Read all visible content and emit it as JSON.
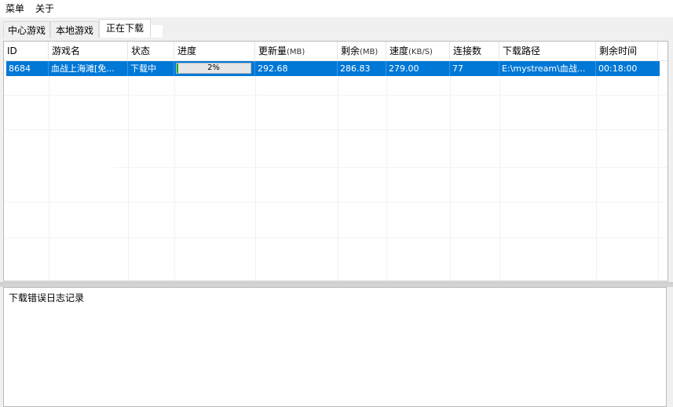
{
  "menu": {
    "items": [
      "菜单",
      "关于"
    ]
  },
  "tabs": [
    {
      "label": "中心游戏",
      "active": false
    },
    {
      "label": "本地游戏",
      "active": false
    },
    {
      "label": "正在下载",
      "active": true
    }
  ],
  "table": {
    "columns": [
      {
        "label": "ID",
        "unit": ""
      },
      {
        "label": "游戏名",
        "unit": ""
      },
      {
        "label": "状态",
        "unit": ""
      },
      {
        "label": "进度",
        "unit": ""
      },
      {
        "label": "更新量",
        "unit": "(MB)"
      },
      {
        "label": "剩余",
        "unit": "(MB)"
      },
      {
        "label": "速度",
        "unit": "(KB/S)"
      },
      {
        "label": "连接数",
        "unit": ""
      },
      {
        "label": "下载路径",
        "unit": ""
      },
      {
        "label": "剩余时间",
        "unit": ""
      }
    ],
    "rows": [
      {
        "id": "8684",
        "name": "血战上海滩[免...",
        "status": "下载中",
        "progress_text": "2%",
        "progress_value": 0.02,
        "update_mb": "292.68",
        "remaining_mb": "286.83",
        "speed": "279.00",
        "connections": "77",
        "path": "E:\\mystream\\血战...",
        "time_left": "00:18:00",
        "selected": true
      }
    ]
  },
  "log": {
    "title": "下载错误日志记录"
  },
  "colors": {
    "selection": "#0078d7",
    "progress_fill": "#06b025",
    "panel_bg": "#f0f0f0"
  }
}
